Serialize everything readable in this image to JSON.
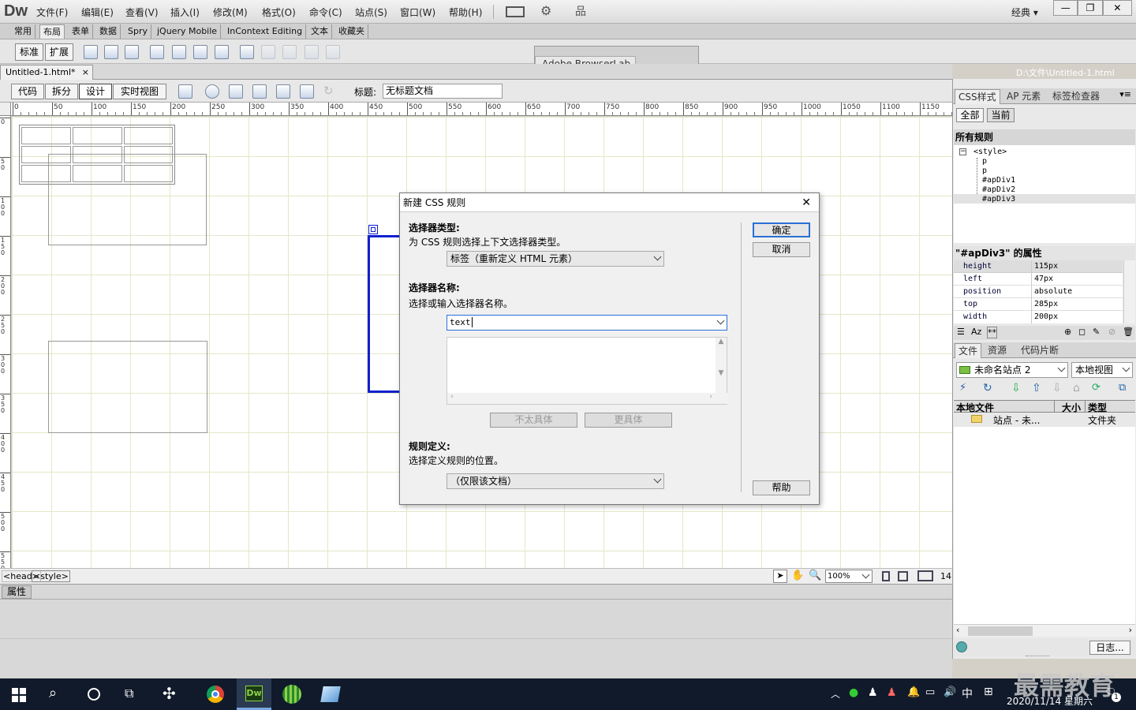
{
  "app": {
    "logo": "Dw",
    "workspace": "经典 ▾",
    "window_controls": [
      "—",
      "❐",
      "✕"
    ]
  },
  "menu": [
    "文件(F)",
    "编辑(E)",
    "查看(V)",
    "插入(I)",
    "修改(M)",
    "格式(O)",
    "命令(C)",
    "站点(S)",
    "窗口(W)",
    "帮助(H)"
  ],
  "insert_tabs": [
    "常用",
    "布局",
    "表单",
    "数据",
    "Spry",
    "jQuery Mobile",
    "InContext Editing",
    "文本",
    "收藏夹"
  ],
  "layout_buttons": [
    "标准",
    "扩展"
  ],
  "browserlab": {
    "title": "Adobe BrowserLab"
  },
  "document": {
    "tab": "Untitled-1.html*",
    "path": "D:\\文件\\Untitled-1.html",
    "close": "×"
  },
  "view_buttons": [
    "代码",
    "拆分",
    "设计",
    "实时视图"
  ],
  "title_label": "标题:",
  "title_value": "无标题文档",
  "ruler": {
    "labels": [
      "0",
      "50",
      "100",
      "150",
      "200",
      "250",
      "300",
      "350",
      "400",
      "450",
      "500",
      "550",
      "600",
      "650",
      "700",
      "750",
      "800",
      "850",
      "900",
      "950",
      "1000",
      "1050",
      "1100",
      "1150"
    ],
    "v_labels": [
      "0",
      "5 0",
      "1 0 0",
      "1 5 0",
      "2 0 0",
      "2 5 0",
      "3 0 0",
      "3 5 0",
      "4 0 0",
      "4 5 0",
      "5 0 0",
      "5 5 0"
    ]
  },
  "tag_selector": [
    "<head>",
    "<style>"
  ],
  "statusbar": {
    "zoom": "100%",
    "size": "14:"
  },
  "properties": {
    "title": "属性"
  },
  "css_panel": {
    "tabs": [
      "CSS样式",
      "AP 元素",
      "标签检查器"
    ],
    "modes": [
      "全部",
      "当前"
    ],
    "rules_title": "所有规则",
    "tree": [
      "<style>",
      "p",
      "p",
      "#apDiv1",
      "#apDiv2",
      "#apDiv3"
    ],
    "props_title": "\"#apDiv3\" 的属性",
    "props": [
      {
        "k": "height",
        "v": "115px"
      },
      {
        "k": "left",
        "v": "47px"
      },
      {
        "k": "position",
        "v": "absolute"
      },
      {
        "k": "top",
        "v": "285px"
      },
      {
        "k": "width",
        "v": "200px"
      }
    ]
  },
  "files_panel": {
    "tabs": [
      "文件",
      "资源",
      "代码片断"
    ],
    "site": "未命名站点 2",
    "view": "本地视图",
    "columns": [
      "本地文件",
      "大小",
      "类型"
    ],
    "row": {
      "name": "站点 - 未...",
      "type": "文件夹"
    },
    "log_button": "日志..."
  },
  "dialog": {
    "title": "新建 CSS 规则",
    "close": "✕",
    "sel_type_title": "选择器类型:",
    "sel_type_desc": "为 CSS 规则选择上下文选择器类型。",
    "sel_type_value": "标签（重新定义 HTML 元素）",
    "sel_name_title": "选择器名称:",
    "sel_name_desc": "选择或输入选择器名称。",
    "sel_name_value": "text",
    "less_specific": "不太具体",
    "more_specific": "更具体",
    "rule_def_title": "规则定义:",
    "rule_def_desc": "选择定义规则的位置。",
    "rule_def_value": "（仅限该文档）",
    "ok": "确定",
    "cancel": "取消",
    "help": "帮助"
  },
  "taskbar": {
    "ime": "中",
    "date": "2020/11/14 星期六",
    "watermark": "最需教育",
    "notif_count": "1"
  }
}
